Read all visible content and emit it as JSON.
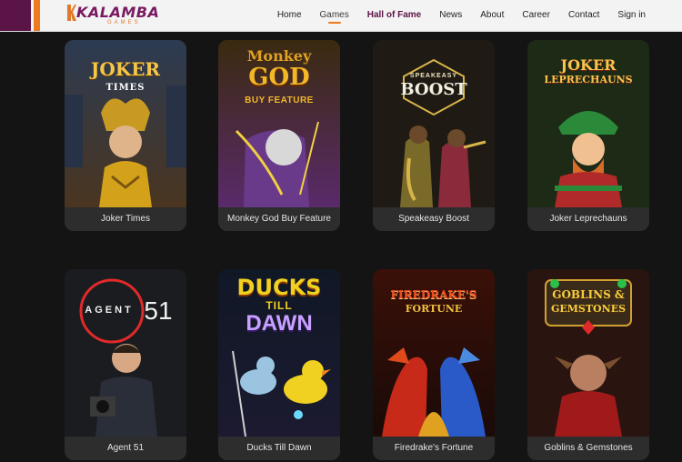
{
  "header": {
    "logo_text": "KALAMBA",
    "logo_sub": "GAMES",
    "nav": [
      {
        "label": "Home",
        "state": "normal"
      },
      {
        "label": "Games",
        "state": "active"
      },
      {
        "label": "Hall of Fame",
        "state": "highlight"
      },
      {
        "label": "News",
        "state": "normal"
      },
      {
        "label": "About",
        "state": "normal"
      },
      {
        "label": "Career",
        "state": "normal"
      },
      {
        "label": "Contact",
        "state": "normal"
      },
      {
        "label": "Sign in",
        "state": "normal"
      }
    ]
  },
  "games": [
    {
      "title": "Joker Times",
      "logo": [
        "JOKER",
        "TIMES"
      ]
    },
    {
      "title": "Monkey God Buy Feature",
      "logo": [
        "Monkey",
        "GOD",
        "BUY FEATURE"
      ]
    },
    {
      "title": "Speakeasy Boost",
      "logo": [
        "SPEAKEASY",
        "BOOST"
      ]
    },
    {
      "title": "Joker Leprechauns",
      "logo": [
        "JOKER",
        "LEPRECHAUNS"
      ]
    },
    {
      "title": "Agent 51",
      "logo": [
        "AGENT",
        "51"
      ]
    },
    {
      "title": "Ducks Till Dawn",
      "logo": [
        "DUCKS",
        "TILL",
        "DAWN"
      ]
    },
    {
      "title": "Firedrake's Fortune",
      "logo": [
        "FIREDRAKE'S",
        "FORTUNE"
      ]
    },
    {
      "title": "Goblins & Gemstones",
      "logo": [
        "GOBLINS &",
        "GEMSTONES"
      ]
    }
  ],
  "colors": {
    "brand_purple": "#5a1446",
    "brand_orange": "#f07a1e",
    "page_bg": "#141414"
  }
}
